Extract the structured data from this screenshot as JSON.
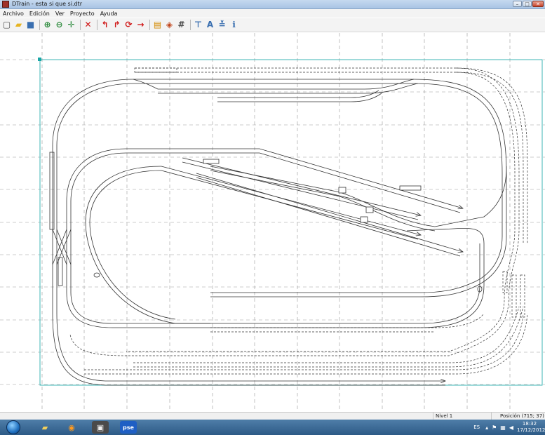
{
  "window": {
    "title": "DTrain - esta si que si.dtr",
    "buttons": {
      "minimize": "–",
      "maximize": "□",
      "close": "✕"
    }
  },
  "menu": [
    "Archivo",
    "Edición",
    "Ver",
    "Proyecto",
    "Ayuda"
  ],
  "toolbar": {
    "icons": [
      {
        "name": "new-file-icon",
        "glyph": "▢",
        "color": "#4a4a4a"
      },
      {
        "name": "open-folder-icon",
        "glyph": "▰",
        "color": "#e6b422"
      },
      {
        "name": "save-icon",
        "glyph": "■",
        "color": "#3a6fb0"
      },
      {
        "sep": true
      },
      {
        "name": "zoom-in-icon",
        "glyph": "⊕",
        "color": "#2c8a3c"
      },
      {
        "name": "zoom-out-icon",
        "glyph": "⊖",
        "color": "#2c8a3c"
      },
      {
        "name": "pan-move-icon",
        "glyph": "✛",
        "color": "#2c8a3c"
      },
      {
        "sep": true
      },
      {
        "name": "delete-icon",
        "glyph": "✕",
        "color": "#d01818"
      },
      {
        "sep": true
      },
      {
        "name": "curve-left-icon",
        "glyph": "↰",
        "color": "#d01818"
      },
      {
        "name": "curve-right-icon",
        "glyph": "↱",
        "color": "#d01818"
      },
      {
        "name": "rotate-icon",
        "glyph": "⟳",
        "color": "#d01818"
      },
      {
        "name": "straight-track-icon",
        "glyph": "→",
        "color": "#d01818"
      },
      {
        "sep": true
      },
      {
        "name": "list-icon",
        "glyph": "▤",
        "color": "#d48a00"
      },
      {
        "name": "palette-icon",
        "glyph": "◈",
        "color": "#c0441a"
      },
      {
        "name": "grid-icon",
        "glyph": "#",
        "color": "#4a4a4a"
      },
      {
        "sep": true
      },
      {
        "name": "level-icon",
        "glyph": "⊤",
        "color": "#3a6fb0"
      },
      {
        "name": "text-icon",
        "glyph": "A",
        "color": "#3a6fb0"
      },
      {
        "name": "label-icon",
        "glyph": "≚",
        "color": "#3a6fb0"
      },
      {
        "name": "info-icon",
        "glyph": "ℹ",
        "color": "#3a6fb0"
      }
    ]
  },
  "status": {
    "level": "Nivel 1",
    "position": "Posición (715; 37)"
  },
  "taskbar": {
    "buttons": [
      {
        "name": "explorer-folder-icon",
        "glyph": "▰",
        "color": "#f2cf5b",
        "bg": "transparent"
      },
      {
        "name": "media-player-icon",
        "glyph": "◉",
        "color": "#ff9a1f",
        "bg": "transparent"
      },
      {
        "name": "dtrain-app-icon",
        "glyph": "▣",
        "color": "#f0f0f0",
        "bg": "#4a4a4a"
      },
      {
        "name": "pse-app-icon",
        "glyph": "pse",
        "color": "#ffffff",
        "bg": "#1f5fc4"
      }
    ],
    "language": "ES",
    "time": "18:32",
    "date": "17/12/2012"
  }
}
